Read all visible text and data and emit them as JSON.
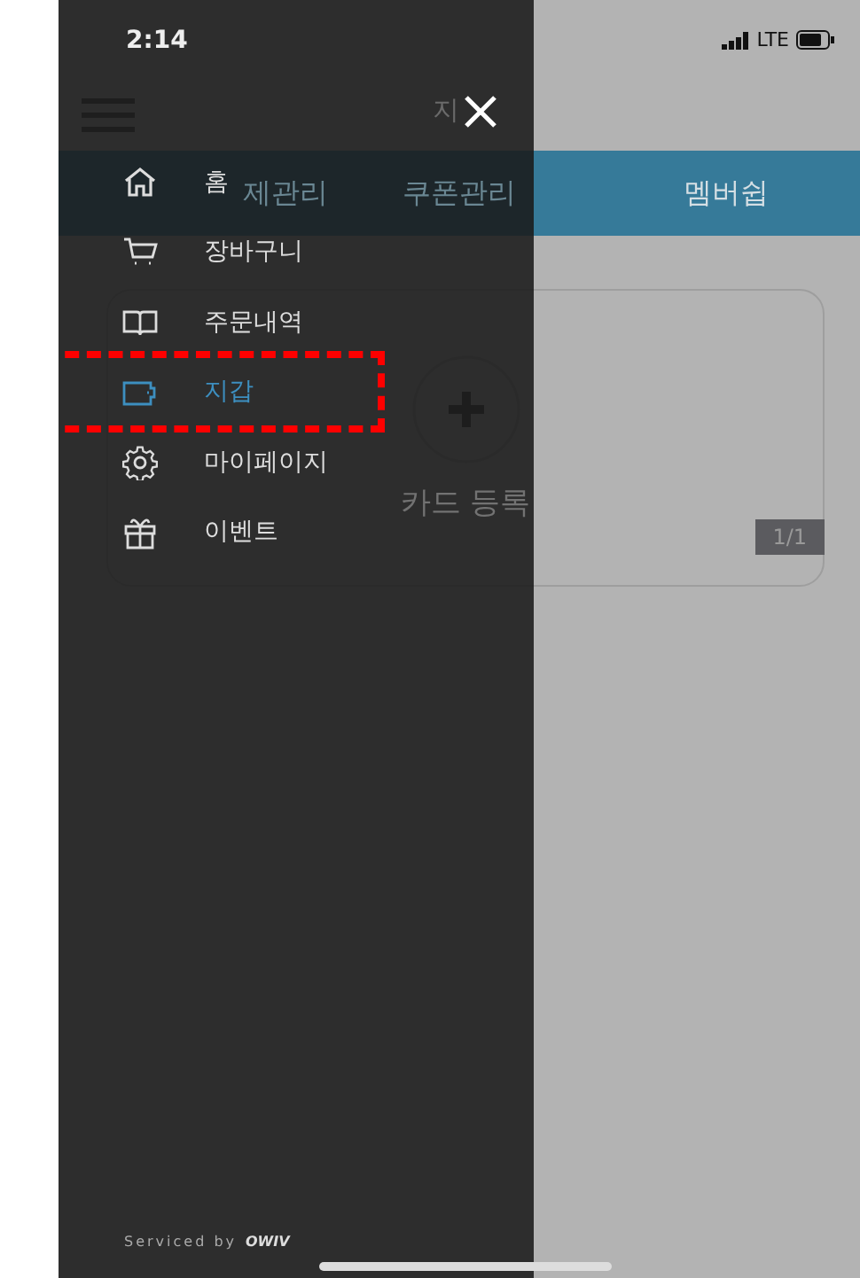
{
  "status_bar": {
    "time": "2:14",
    "network": "LTE"
  },
  "page": {
    "title": "지",
    "tabs": [
      {
        "label": "제관리",
        "selected": false
      },
      {
        "label": "쿠폰관리",
        "selected": false
      },
      {
        "label": "멤버쉽",
        "selected": true
      }
    ],
    "card": {
      "label": "카드 등록",
      "counter": "1/1"
    }
  },
  "drawer": {
    "items": [
      {
        "kind": "home",
        "label": "홈",
        "selected": false
      },
      {
        "kind": "cart",
        "label": "장바구니",
        "selected": false
      },
      {
        "kind": "book",
        "label": "주문내역",
        "selected": false
      },
      {
        "kind": "wallet",
        "label": "지갑",
        "selected": true
      },
      {
        "kind": "gear",
        "label": "마이페이지",
        "selected": false
      },
      {
        "kind": "gift",
        "label": "이벤트",
        "selected": false
      }
    ],
    "footer": {
      "text": "Serviced by",
      "brand": "OWIV"
    }
  }
}
